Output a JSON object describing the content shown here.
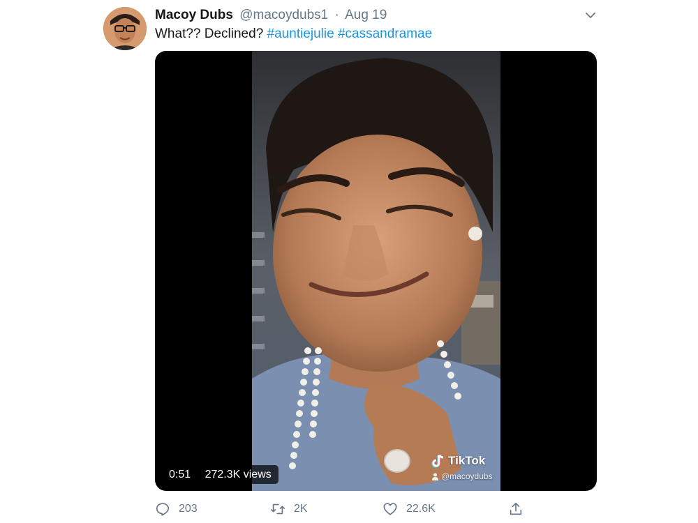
{
  "tweet": {
    "author": {
      "name": "Macoy Dubs",
      "handle": "@macoydubs1",
      "separator": "·",
      "date": "Aug 19"
    },
    "text_plain": "What?? Declined?",
    "hashtags": [
      "#auntiejulie",
      "#cassandramae"
    ],
    "media": {
      "duration": "0:51",
      "views": "272.3K views",
      "watermark": {
        "brand": "TikTok",
        "user": "@macoydubs"
      }
    },
    "actions": {
      "replies": "203",
      "retweets": "2K",
      "likes": "22.6K"
    },
    "icons": {
      "caret": "chevron-down-icon",
      "reply": "reply-icon",
      "retweet": "retweet-icon",
      "like": "heart-icon",
      "share": "share-icon"
    }
  },
  "colors": {
    "text_primary": "#14171a",
    "text_secondary": "#657786",
    "hashtag": "#1b95e0",
    "media_background": "#000000"
  }
}
